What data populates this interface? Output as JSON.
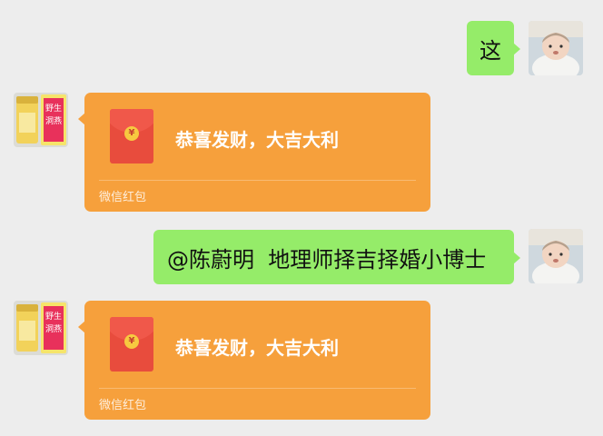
{
  "messages": [
    {
      "side": "right",
      "type": "text",
      "text": "这"
    },
    {
      "side": "left",
      "type": "red_packet",
      "title": "恭喜发财，大吉大利",
      "footer": "微信红包",
      "icon": "yuan-coin-icon",
      "coin_symbol": "¥"
    },
    {
      "side": "right",
      "type": "text",
      "text": "@陈蔚明  地理师择吉择婚小博士"
    },
    {
      "side": "left",
      "type": "red_packet",
      "title": "恭喜发财，大吉大利",
      "footer": "微信红包",
      "icon": "yuan-coin-icon",
      "coin_symbol": "¥"
    }
  ],
  "avatars": {
    "self": {
      "icon": "baby-avatar"
    },
    "other": {
      "icon": "jar-product-avatar",
      "jar_label": "野生洞燕"
    }
  },
  "colors": {
    "background": "#ededed",
    "bubble_green": "#95ec69",
    "red_packet": "#f6a03c",
    "envelope": "#e84c3d"
  }
}
